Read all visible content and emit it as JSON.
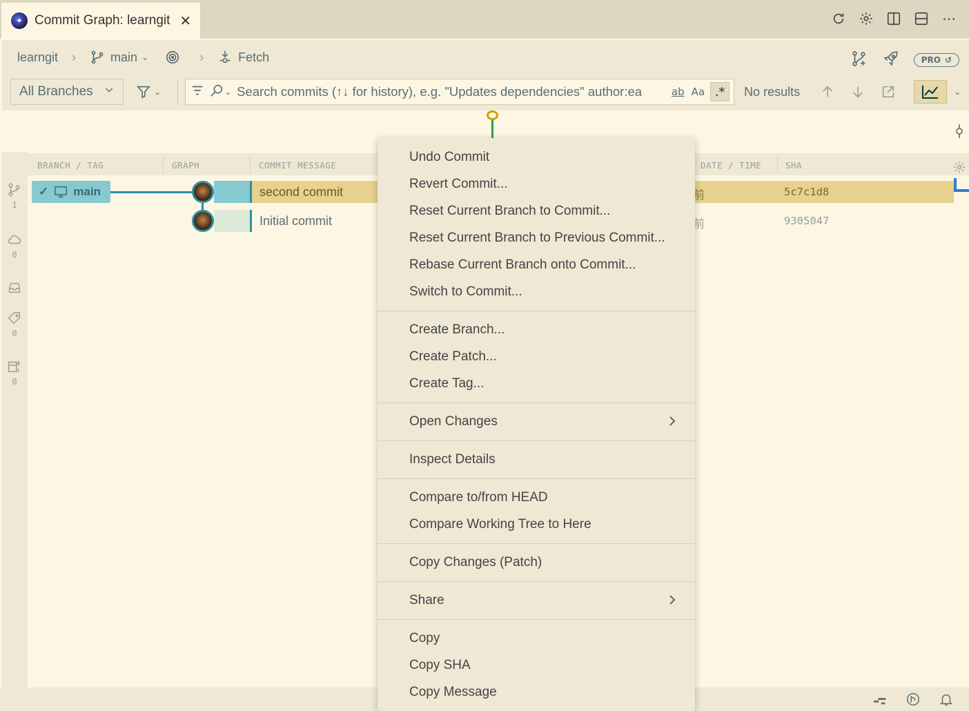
{
  "tab": {
    "title": "Commit Graph: learngit",
    "close": "✕"
  },
  "tab_actions": [
    "refresh-icon",
    "gear-icon",
    "split-editor-icon",
    "layout-icon",
    "more-icon"
  ],
  "breadcrumb": {
    "repo": "learngit",
    "branch": "main",
    "fetch": "Fetch"
  },
  "header_right": {
    "pro": "PRO"
  },
  "toolbar": {
    "branch_select": "All Branches",
    "search_placeholder": "Search commits (↑↓ for history), e.g. \"Updates dependencies\" author:ea",
    "match_word": "ab",
    "match_case": "Aa",
    "regex": ".*",
    "no_results": "No results"
  },
  "columns": {
    "branch_tag": "BRANCH / TAG",
    "graph": "GRAPH",
    "message": "COMMIT MESSAGE",
    "date_time": "DATE / TIME",
    "sha": "SHA"
  },
  "left_counts": {
    "branches": "1",
    "remotes": "0",
    "tags": "0",
    "worktrees": "0"
  },
  "branch_chip": {
    "label": "main"
  },
  "commits": [
    {
      "message": "second commit",
      "date": "前",
      "sha": "5c7c1d8"
    },
    {
      "message": "Initial commit",
      "date": "前",
      "sha": "9305047"
    }
  ],
  "context_menu": {
    "undo": "Undo Commit",
    "revert": "Revert Commit...",
    "reset": "Reset Current Branch to Commit...",
    "reset_prev": "Reset Current Branch to Previous Commit...",
    "rebase": "Rebase Current Branch onto Commit...",
    "switch": "Switch to Commit...",
    "create_branch": "Create Branch...",
    "create_patch": "Create Patch...",
    "create_tag": "Create Tag...",
    "open_changes": "Open Changes",
    "inspect": "Inspect Details",
    "compare_head": "Compare to/from HEAD",
    "compare_wt": "Compare Working Tree to Here",
    "copy_changes": "Copy Changes (Patch)",
    "share": "Share",
    "copy": "Copy",
    "copy_sha": "Copy SHA",
    "copy_message": "Copy Message"
  }
}
